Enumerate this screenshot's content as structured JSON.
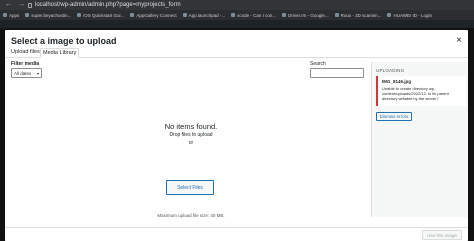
{
  "browser": {
    "url": "localhost/wp-admin/admin.php?page=myprojects_form",
    "bookmarks": [
      "Apps",
      "super.beyachostin...",
      "iOS Quickstart Gui...",
      "AppGallery Connect",
      "App.launchpad -...",
      "xcode - Can I con...",
      "Driver.rm - Google...",
      "Roux - 3D scannin...",
      "HUAWEI ID - Login"
    ]
  },
  "modal": {
    "title": "Select a image to upload",
    "close_icon": "close-icon",
    "tabs": [
      {
        "label": "Upload files",
        "active": false
      },
      {
        "label": "Media Library",
        "active": true
      }
    ],
    "filter": {
      "label": "Filter media",
      "selected": "All dates"
    },
    "search": {
      "label": "Search",
      "value": ""
    },
    "empty": {
      "heading": "No items found.",
      "drop_text": "Drop files to upload",
      "or_text": "or",
      "select_button": "Select Files",
      "max_size": "Maximum upload file size: 40 MB."
    },
    "sidebar": {
      "uploading_label": "UPLOADING",
      "error_file": "IMG_8146.jpg",
      "error_message": "Unable to create directory wp-content/uploads/2022/12. Is its parent directory writable by the server?",
      "dismiss_button": "Dismiss errors"
    },
    "footer": {
      "use_button": "Use this image"
    }
  },
  "colors": {
    "accent": "#2271b1",
    "error": "#d63638"
  }
}
